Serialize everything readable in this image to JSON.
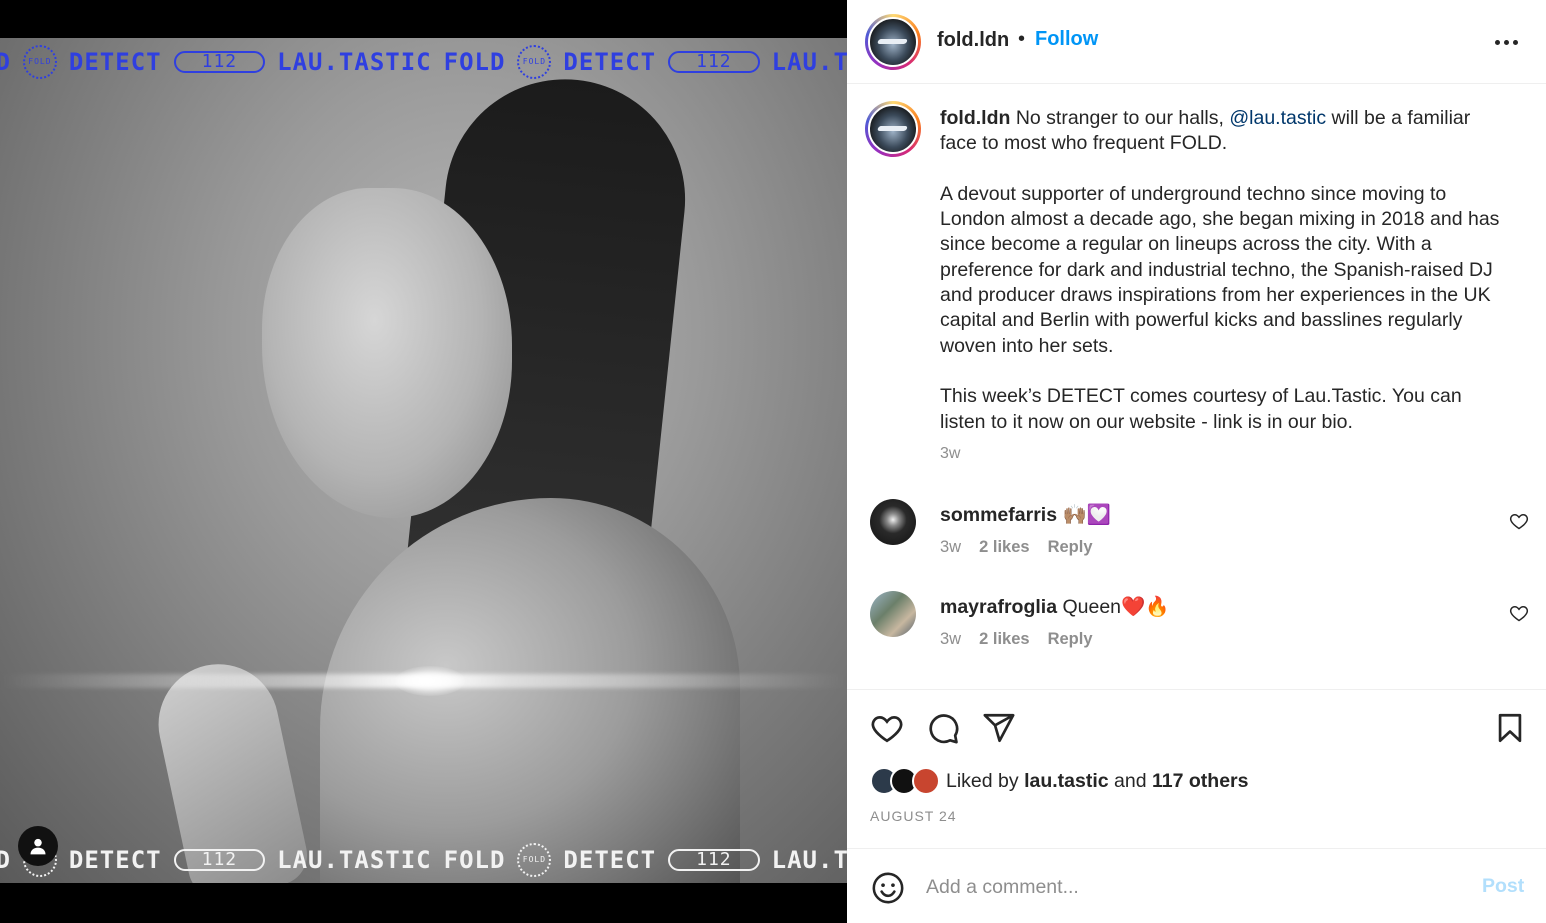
{
  "media": {
    "ticker_items": [
      {
        "type": "text",
        "value": "LD"
      },
      {
        "type": "star",
        "value": "FOLD"
      },
      {
        "type": "text",
        "value": "DETECT"
      },
      {
        "type": "pill",
        "value": "112"
      },
      {
        "type": "text",
        "value": "LAU.TASTIC"
      },
      {
        "type": "text",
        "value": "FOLD"
      },
      {
        "type": "star",
        "value": "FOLD"
      },
      {
        "type": "text",
        "value": "DETECT"
      },
      {
        "type": "pill",
        "value": "112"
      },
      {
        "type": "text",
        "value": "LAU.TAST"
      }
    ],
    "ticker_top_color": "#2f3fe0",
    "ticker_bottom_color": "#f2f2f2",
    "user_tag_icon": "person-icon"
  },
  "header": {
    "username": "fold.ldn",
    "separator": "•",
    "follow_label": "Follow",
    "more_icon": "more-options-icon"
  },
  "caption": {
    "username": "fold.ldn",
    "intro_before": "No stranger to our halls,",
    "mention": "@lau.tastic",
    "intro_after": "will be a familiar face to most who frequent FOLD.",
    "paragraph2": "A devout supporter of underground techno since moving to London almost a decade ago, she began mixing in 2018 and has since become a regular on lineups across the city. With a preference for dark and industrial techno, the Spanish-raised DJ and producer draws inspirations from her experiences in the UK capital and Berlin with powerful kicks and basslines regularly woven into her sets.",
    "paragraph3": "This week’s DETECT comes courtesy of Lau.Tastic. You can listen to it now on our website - link is in our bio.",
    "time": "3w"
  },
  "comments": [
    {
      "username": "sommefarris",
      "text": "🙌🏽💟",
      "time": "3w",
      "likes": "2 likes",
      "reply": "Reply"
    },
    {
      "username": "mayrafroglia",
      "text": "Queen❤️🔥",
      "time": "3w",
      "likes": "2 likes",
      "reply": "Reply"
    }
  ],
  "actions": {
    "like_icon": "heart-icon",
    "comment_icon": "comment-icon",
    "share_icon": "share-icon",
    "save_icon": "bookmark-icon",
    "liked_by_prefix": "Liked by",
    "liked_by_user": "lau.tastic",
    "liked_by_and": "and",
    "liked_by_others": "117 others",
    "date": "AUGUST 24"
  },
  "add_comment": {
    "placeholder": "Add a comment...",
    "post_label": "Post",
    "emoji_icon": "emoji-icon"
  },
  "colors": {
    "accent": "#0095f6",
    "mention": "#00376b",
    "muted": "#8e8e8e",
    "post_disabled": "#b2dffc"
  }
}
